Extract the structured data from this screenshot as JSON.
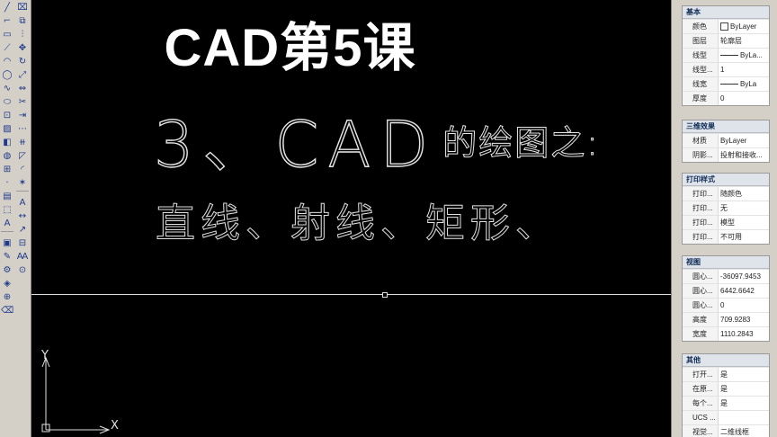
{
  "overlay_title": "CAD第5课",
  "drawing": {
    "line1_main": "3、CAD",
    "line1_tail": "的绘图之:",
    "line2": "直线、射线、矩形、"
  },
  "ucs": {
    "x": "X",
    "y": "Y"
  },
  "toolbar_icons": [
    "line-icon",
    "polyline-icon",
    "rectangle-icon",
    "construction-line-icon",
    "arc-icon",
    "move-icon",
    "circle-icon",
    "rotate-icon",
    "spline-icon",
    "ellipse-icon",
    "insert-block-icon",
    "hatch-icon",
    "gradient-icon",
    "region-icon",
    "table-icon",
    "multiline-text-icon",
    "point-icon",
    "trim-icon",
    "extend-icon",
    "break-icon",
    "chamfer-icon",
    "fillet-icon",
    "explode-icon",
    "text-icon",
    "dimension-icon",
    "leader-icon",
    "layer-icon",
    "match-properties-icon",
    "properties-icon",
    "zoom-icon"
  ],
  "properties": {
    "general": {
      "title": "基本",
      "rows": [
        {
          "key": "颜色",
          "value": "ByLayer"
        },
        {
          "key": "图层",
          "value": "轮廓层"
        },
        {
          "key": "线型",
          "value": "ByLa..."
        },
        {
          "key": "线型...",
          "value": "1"
        },
        {
          "key": "线宽",
          "value": "ByLa"
        },
        {
          "key": "厚度",
          "value": "0"
        }
      ]
    },
    "3d": {
      "title": "三维效果",
      "rows": [
        {
          "key": "材质",
          "value": "ByLayer"
        },
        {
          "key": "阴影...",
          "value": "投射和接收..."
        }
      ]
    },
    "plot": {
      "title": "打印样式",
      "rows": [
        {
          "key": "打印...",
          "value": "随颜色"
        },
        {
          "key": "打印...",
          "value": "无"
        },
        {
          "key": "打印...",
          "value": "模型"
        },
        {
          "key": "打印...",
          "value": "不可用"
        }
      ]
    },
    "view": {
      "title": "视图",
      "rows": [
        {
          "key": "圆心...",
          "value": "-36097.9453"
        },
        {
          "key": "圆心...",
          "value": "6442.6642"
        },
        {
          "key": "圆心...",
          "value": "0"
        },
        {
          "key": "高度",
          "value": "709.9283"
        },
        {
          "key": "宽度",
          "value": "1110.2843"
        }
      ]
    },
    "misc": {
      "title": "其他",
      "rows": [
        {
          "key": "打开...",
          "value": "是"
        },
        {
          "key": "在原...",
          "value": "是"
        },
        {
          "key": "每个...",
          "value": "是"
        },
        {
          "key": "UCS ...",
          "value": ""
        },
        {
          "key": "视觉...",
          "value": "二维线框"
        }
      ]
    }
  }
}
